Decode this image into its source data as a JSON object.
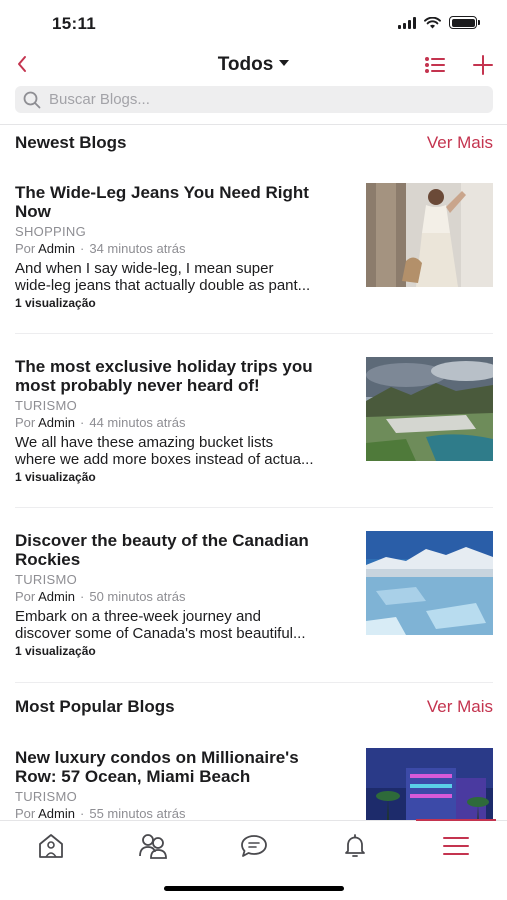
{
  "status_bar": {
    "time": "15:11"
  },
  "nav": {
    "title": "Todos"
  },
  "search": {
    "placeholder": "Buscar Blogs..."
  },
  "sections": {
    "newest": {
      "title": "Newest Blogs",
      "link": "Ver Mais"
    },
    "popular": {
      "title": "Most Popular Blogs",
      "link": "Ver Mais"
    }
  },
  "blogs": [
    {
      "title_line1": "The Wide-Leg Jeans You Need Right",
      "title_line2": "Now",
      "category": "SHOPPING",
      "by": "Por",
      "author": "Admin",
      "time": "34 minutos atrás",
      "excerpt_line1": "And when I say wide-leg, I mean super",
      "excerpt_line2": "wide-leg jeans that actually double as pant...",
      "views": "1 visualização",
      "image": "woman-fashion-photo"
    },
    {
      "title_line1": "The most exclusive holiday trips you",
      "title_line2": "most probably never heard of!",
      "category": "TURISMO",
      "by": "Por",
      "author": "Admin",
      "time": "44 minutos atrás",
      "excerpt_line1": "We all have these amazing bucket lists",
      "excerpt_line2": "where we add more boxes instead of actua...",
      "views": "1 visualização",
      "image": "coastal-city-mountain-photo"
    },
    {
      "title_line1": "Discover the beauty of the Canadian",
      "title_line2": "Rockies",
      "category": "TURISMO",
      "by": "Por",
      "author": "Admin",
      "time": "50 minutos atrás",
      "excerpt_line1": "Embark on a three-week journey and",
      "excerpt_line2": "discover some of Canada's most beautiful...",
      "views": "1 visualização",
      "image": "frozen-lake-mountains-photo"
    },
    {
      "title_line1": "New luxury condos on Millionaire's",
      "title_line2": "Row: 57 Ocean, Miami Beach",
      "category": "TURISMO",
      "by": "Por",
      "author": "Admin",
      "time": "55 minutos atrás",
      "image": "night-hotel-palms-photo"
    }
  ],
  "tabs": [
    "home-icon",
    "community-icon",
    "chat-icon",
    "bell-icon",
    "menu-icon"
  ],
  "colors": {
    "accent": "#c4344f",
    "text": "#1c1c1e",
    "muted": "#8e8e93"
  }
}
